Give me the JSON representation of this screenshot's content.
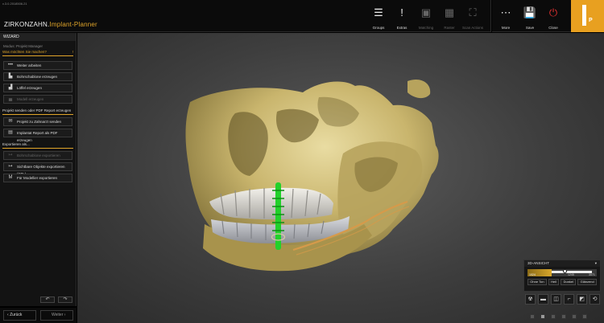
{
  "app": {
    "version": "v.3.0.2018506.21",
    "brand_main": "ZIRKONZAHN.",
    "brand_sub": "Implant-Planner"
  },
  "toolbar": {
    "items": [
      {
        "label": "Groups",
        "icon": "menu-lines-icon"
      },
      {
        "label": "Extras",
        "icon": "exclamation-icon"
      },
      {
        "label": "Matching",
        "icon": "matching-icon"
      },
      {
        "label": "Raster",
        "icon": "raster-icon"
      },
      {
        "label": "Scan Actions",
        "icon": "scan-actions-icon"
      }
    ],
    "right_items": [
      {
        "label": "More",
        "icon": "more-dots-icon"
      },
      {
        "label": "Save",
        "icon": "save-disk-icon"
      },
      {
        "label": "Close",
        "icon": "power-icon"
      }
    ],
    "logo_letters": "IP"
  },
  "wizard": {
    "title": "WIZARD",
    "modus": "Modus: Projekt Manager",
    "question": "Was möchten Sie machen?",
    "question_marker": "!",
    "actions": [
      {
        "label": "Weiter arbeiten",
        "icon": "dots-icon"
      },
      {
        "label": "Bohrschablone erzeugen",
        "icon": "drill-guide-icon"
      },
      {
        "label": "Löffel erzeugen",
        "icon": "tray-icon"
      },
      {
        "label": "Modell erzeugen",
        "icon": "model-icon"
      }
    ],
    "section_send": "Projekt senden oder PDF Report erzeugen",
    "send_actions": [
      {
        "label": "Projekt zu Zahnarzt senden",
        "icon": "mail-icon"
      },
      {
        "label": "Implantat Report als PDF erzeugen",
        "icon": "pdf-icon"
      }
    ],
    "section_export": "Exportieren als...",
    "export_actions": [
      {
        "label": "Bohrschablone exportieren",
        "icon": "export-icon"
      },
      {
        "label": "Sichtbare Objekte exportieren (STL)",
        "icon": "export-stl-icon"
      },
      {
        "label": "Für Modellier exportieren",
        "icon": "modellier-icon"
      }
    ]
  },
  "nav": {
    "back_label": "Zurück",
    "next_label": "Weiter"
  },
  "view_panel": {
    "title": "3D-ANSICHT",
    "slider_value": "1024",
    "slider_range_labels": [
      "1245",
      "3071"
    ],
    "buttons": [
      "Ohne Ton",
      "Hell",
      "Dunkel",
      "Glänzend"
    ]
  },
  "view_icons": [
    "xray-icon",
    "slice-icon",
    "panorama-icon",
    "corner-icon",
    "cube-icon",
    "reset-view-icon"
  ],
  "colors": {
    "accent": "#e0a52a",
    "bone": "#cdbb78",
    "implant": "#22d12a"
  }
}
